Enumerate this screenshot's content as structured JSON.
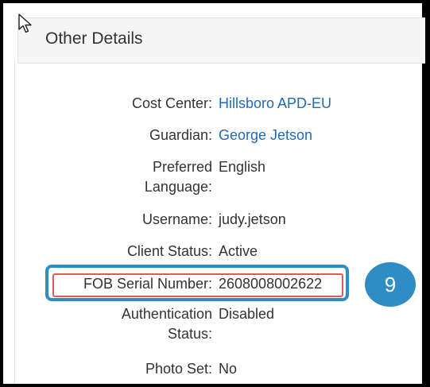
{
  "panel": {
    "title": "Other Details"
  },
  "details": [
    {
      "label": "Cost Center:",
      "value": "Hillsboro APD-EU",
      "link": true
    },
    {
      "label": "Guardian:",
      "value": "George Jetson",
      "link": true
    },
    {
      "label_line1": "Preferred",
      "label_line2": "Language:",
      "value": "English"
    },
    {
      "label": "Username:",
      "value": "judy.jetson"
    },
    {
      "label": "Client Status:",
      "value": "Active"
    },
    {
      "label": "FOB Serial Number:",
      "value": "2608008002622"
    },
    {
      "label_line1": "Authentication",
      "label_line2": "Status:",
      "value": "Disabled"
    },
    {
      "label": "Photo Set:",
      "value": "No"
    }
  ],
  "callout": {
    "step": "9"
  },
  "colors": {
    "link": "#1f6bb6",
    "callout_blue": "#2f8cc4",
    "highlight_red": "#e05a5a"
  },
  "icons": {
    "cursor": "mouse-pointer-icon"
  }
}
